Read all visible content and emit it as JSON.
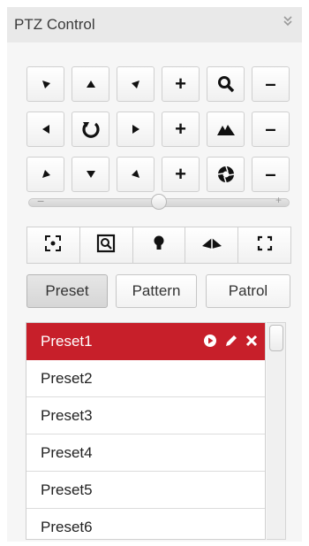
{
  "header": {
    "title": "PTZ Control",
    "collapse_icon": "double-chevron-down-icon"
  },
  "ptz_buttons": [
    {
      "name": "pan-up-left",
      "icon": "arrow-up-left-icon"
    },
    {
      "name": "pan-up",
      "icon": "arrow-up-icon"
    },
    {
      "name": "pan-up-right",
      "icon": "arrow-up-right-icon"
    },
    {
      "name": "zoom-in",
      "icon": "plus-icon",
      "text": "+"
    },
    {
      "name": "zoom-icon",
      "icon": "magnifier-icon"
    },
    {
      "name": "zoom-out",
      "icon": "minus-icon",
      "text": "–"
    },
    {
      "name": "pan-left",
      "icon": "arrow-left-icon"
    },
    {
      "name": "auto-rotate",
      "icon": "rotate-icon"
    },
    {
      "name": "pan-right",
      "icon": "arrow-right-icon"
    },
    {
      "name": "focus-near",
      "icon": "plus-icon",
      "text": "+"
    },
    {
      "name": "focus-icon",
      "icon": "mountain-icon"
    },
    {
      "name": "focus-far",
      "icon": "minus-icon",
      "text": "–"
    },
    {
      "name": "pan-down-left",
      "icon": "arrow-down-left-icon"
    },
    {
      "name": "pan-down",
      "icon": "arrow-down-icon"
    },
    {
      "name": "pan-down-right",
      "icon": "arrow-down-right-icon"
    },
    {
      "name": "iris-open",
      "icon": "plus-icon",
      "text": "+"
    },
    {
      "name": "iris-icon",
      "icon": "aperture-icon"
    },
    {
      "name": "iris-close",
      "icon": "minus-icon",
      "text": "–"
    }
  ],
  "speed_slider": {
    "value_fraction": 0.5,
    "minus": "−",
    "plus": "+"
  },
  "tools": [
    {
      "name": "3d-positioning",
      "icon": "target-frame-icon"
    },
    {
      "name": "manual-tracking",
      "icon": "square-magnifier-icon"
    },
    {
      "name": "light",
      "icon": "bulb-icon"
    },
    {
      "name": "wiper",
      "icon": "wiper-icon"
    },
    {
      "name": "fullscreen",
      "icon": "expand-corners-icon"
    }
  ],
  "tabs": [
    {
      "label": "Preset",
      "active": true
    },
    {
      "label": "Pattern",
      "active": false
    },
    {
      "label": "Patrol",
      "active": false
    }
  ],
  "presets": [
    {
      "label": "Preset1",
      "active": true
    },
    {
      "label": "Preset2",
      "active": false
    },
    {
      "label": "Preset3",
      "active": false
    },
    {
      "label": "Preset4",
      "active": false
    },
    {
      "label": "Preset5",
      "active": false
    },
    {
      "label": "Preset6",
      "active": false
    }
  ],
  "colors": {
    "active_row": "#c71f2a"
  }
}
